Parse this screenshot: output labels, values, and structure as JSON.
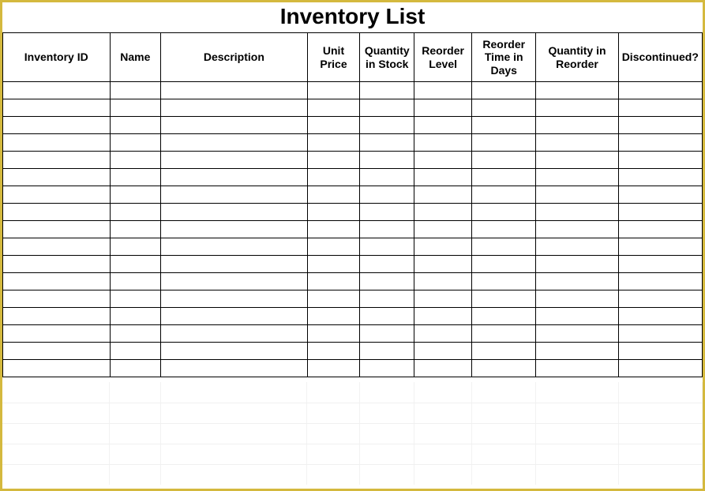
{
  "title": "Inventory List",
  "headers": {
    "inventory_id": "Inventory ID",
    "name": "Name",
    "description": "Description",
    "unit_price": "Unit Price",
    "qty_stock": "Quantity in Stock",
    "reorder_level": "Reorder Level",
    "reorder_days": "Reorder Time in Days",
    "qty_reorder": "Quantity in Reorder",
    "discontinued": "Discontinued?"
  },
  "rows": [
    {
      "inventory_id": "",
      "name": "",
      "description": "",
      "unit_price": "",
      "qty_stock": "",
      "reorder_level": "",
      "reorder_days": "",
      "qty_reorder": "",
      "discontinued": ""
    },
    {
      "inventory_id": "",
      "name": "",
      "description": "",
      "unit_price": "",
      "qty_stock": "",
      "reorder_level": "",
      "reorder_days": "",
      "qty_reorder": "",
      "discontinued": ""
    },
    {
      "inventory_id": "",
      "name": "",
      "description": "",
      "unit_price": "",
      "qty_stock": "",
      "reorder_level": "",
      "reorder_days": "",
      "qty_reorder": "",
      "discontinued": ""
    },
    {
      "inventory_id": "",
      "name": "",
      "description": "",
      "unit_price": "",
      "qty_stock": "",
      "reorder_level": "",
      "reorder_days": "",
      "qty_reorder": "",
      "discontinued": ""
    },
    {
      "inventory_id": "",
      "name": "",
      "description": "",
      "unit_price": "",
      "qty_stock": "",
      "reorder_level": "",
      "reorder_days": "",
      "qty_reorder": "",
      "discontinued": ""
    },
    {
      "inventory_id": "",
      "name": "",
      "description": "",
      "unit_price": "",
      "qty_stock": "",
      "reorder_level": "",
      "reorder_days": "",
      "qty_reorder": "",
      "discontinued": ""
    },
    {
      "inventory_id": "",
      "name": "",
      "description": "",
      "unit_price": "",
      "qty_stock": "",
      "reorder_level": "",
      "reorder_days": "",
      "qty_reorder": "",
      "discontinued": ""
    },
    {
      "inventory_id": "",
      "name": "",
      "description": "",
      "unit_price": "",
      "qty_stock": "",
      "reorder_level": "",
      "reorder_days": "",
      "qty_reorder": "",
      "discontinued": ""
    },
    {
      "inventory_id": "",
      "name": "",
      "description": "",
      "unit_price": "",
      "qty_stock": "",
      "reorder_level": "",
      "reorder_days": "",
      "qty_reorder": "",
      "discontinued": ""
    },
    {
      "inventory_id": "",
      "name": "",
      "description": "",
      "unit_price": "",
      "qty_stock": "",
      "reorder_level": "",
      "reorder_days": "",
      "qty_reorder": "",
      "discontinued": ""
    },
    {
      "inventory_id": "",
      "name": "",
      "description": "",
      "unit_price": "",
      "qty_stock": "",
      "reorder_level": "",
      "reorder_days": "",
      "qty_reorder": "",
      "discontinued": ""
    },
    {
      "inventory_id": "",
      "name": "",
      "description": "",
      "unit_price": "",
      "qty_stock": "",
      "reorder_level": "",
      "reorder_days": "",
      "qty_reorder": "",
      "discontinued": ""
    },
    {
      "inventory_id": "",
      "name": "",
      "description": "",
      "unit_price": "",
      "qty_stock": "",
      "reorder_level": "",
      "reorder_days": "",
      "qty_reorder": "",
      "discontinued": ""
    },
    {
      "inventory_id": "",
      "name": "",
      "description": "",
      "unit_price": "",
      "qty_stock": "",
      "reorder_level": "",
      "reorder_days": "",
      "qty_reorder": "",
      "discontinued": ""
    },
    {
      "inventory_id": "",
      "name": "",
      "description": "",
      "unit_price": "",
      "qty_stock": "",
      "reorder_level": "",
      "reorder_days": "",
      "qty_reorder": "",
      "discontinued": ""
    },
    {
      "inventory_id": "",
      "name": "",
      "description": "",
      "unit_price": "",
      "qty_stock": "",
      "reorder_level": "",
      "reorder_days": "",
      "qty_reorder": "",
      "discontinued": ""
    },
    {
      "inventory_id": "",
      "name": "",
      "description": "",
      "unit_price": "",
      "qty_stock": "",
      "reorder_level": "",
      "reorder_days": "",
      "qty_reorder": "",
      "discontinued": ""
    }
  ]
}
